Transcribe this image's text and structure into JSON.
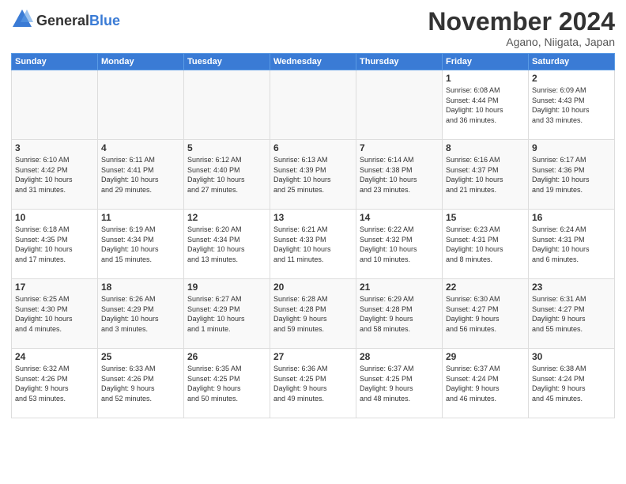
{
  "logo": {
    "general": "General",
    "blue": "Blue"
  },
  "header": {
    "month": "November 2024",
    "location": "Agano, Niigata, Japan"
  },
  "days_of_week": [
    "Sunday",
    "Monday",
    "Tuesday",
    "Wednesday",
    "Thursday",
    "Friday",
    "Saturday"
  ],
  "weeks": [
    [
      {
        "day": "",
        "info": ""
      },
      {
        "day": "",
        "info": ""
      },
      {
        "day": "",
        "info": ""
      },
      {
        "day": "",
        "info": ""
      },
      {
        "day": "",
        "info": ""
      },
      {
        "day": "1",
        "info": "Sunrise: 6:08 AM\nSunset: 4:44 PM\nDaylight: 10 hours\nand 36 minutes."
      },
      {
        "day": "2",
        "info": "Sunrise: 6:09 AM\nSunset: 4:43 PM\nDaylight: 10 hours\nand 33 minutes."
      }
    ],
    [
      {
        "day": "3",
        "info": "Sunrise: 6:10 AM\nSunset: 4:42 PM\nDaylight: 10 hours\nand 31 minutes."
      },
      {
        "day": "4",
        "info": "Sunrise: 6:11 AM\nSunset: 4:41 PM\nDaylight: 10 hours\nand 29 minutes."
      },
      {
        "day": "5",
        "info": "Sunrise: 6:12 AM\nSunset: 4:40 PM\nDaylight: 10 hours\nand 27 minutes."
      },
      {
        "day": "6",
        "info": "Sunrise: 6:13 AM\nSunset: 4:39 PM\nDaylight: 10 hours\nand 25 minutes."
      },
      {
        "day": "7",
        "info": "Sunrise: 6:14 AM\nSunset: 4:38 PM\nDaylight: 10 hours\nand 23 minutes."
      },
      {
        "day": "8",
        "info": "Sunrise: 6:16 AM\nSunset: 4:37 PM\nDaylight: 10 hours\nand 21 minutes."
      },
      {
        "day": "9",
        "info": "Sunrise: 6:17 AM\nSunset: 4:36 PM\nDaylight: 10 hours\nand 19 minutes."
      }
    ],
    [
      {
        "day": "10",
        "info": "Sunrise: 6:18 AM\nSunset: 4:35 PM\nDaylight: 10 hours\nand 17 minutes."
      },
      {
        "day": "11",
        "info": "Sunrise: 6:19 AM\nSunset: 4:34 PM\nDaylight: 10 hours\nand 15 minutes."
      },
      {
        "day": "12",
        "info": "Sunrise: 6:20 AM\nSunset: 4:34 PM\nDaylight: 10 hours\nand 13 minutes."
      },
      {
        "day": "13",
        "info": "Sunrise: 6:21 AM\nSunset: 4:33 PM\nDaylight: 10 hours\nand 11 minutes."
      },
      {
        "day": "14",
        "info": "Sunrise: 6:22 AM\nSunset: 4:32 PM\nDaylight: 10 hours\nand 10 minutes."
      },
      {
        "day": "15",
        "info": "Sunrise: 6:23 AM\nSunset: 4:31 PM\nDaylight: 10 hours\nand 8 minutes."
      },
      {
        "day": "16",
        "info": "Sunrise: 6:24 AM\nSunset: 4:31 PM\nDaylight: 10 hours\nand 6 minutes."
      }
    ],
    [
      {
        "day": "17",
        "info": "Sunrise: 6:25 AM\nSunset: 4:30 PM\nDaylight: 10 hours\nand 4 minutes."
      },
      {
        "day": "18",
        "info": "Sunrise: 6:26 AM\nSunset: 4:29 PM\nDaylight: 10 hours\nand 3 minutes."
      },
      {
        "day": "19",
        "info": "Sunrise: 6:27 AM\nSunset: 4:29 PM\nDaylight: 10 hours\nand 1 minute."
      },
      {
        "day": "20",
        "info": "Sunrise: 6:28 AM\nSunset: 4:28 PM\nDaylight: 9 hours\nand 59 minutes."
      },
      {
        "day": "21",
        "info": "Sunrise: 6:29 AM\nSunset: 4:28 PM\nDaylight: 9 hours\nand 58 minutes."
      },
      {
        "day": "22",
        "info": "Sunrise: 6:30 AM\nSunset: 4:27 PM\nDaylight: 9 hours\nand 56 minutes."
      },
      {
        "day": "23",
        "info": "Sunrise: 6:31 AM\nSunset: 4:27 PM\nDaylight: 9 hours\nand 55 minutes."
      }
    ],
    [
      {
        "day": "24",
        "info": "Sunrise: 6:32 AM\nSunset: 4:26 PM\nDaylight: 9 hours\nand 53 minutes."
      },
      {
        "day": "25",
        "info": "Sunrise: 6:33 AM\nSunset: 4:26 PM\nDaylight: 9 hours\nand 52 minutes."
      },
      {
        "day": "26",
        "info": "Sunrise: 6:35 AM\nSunset: 4:25 PM\nDaylight: 9 hours\nand 50 minutes."
      },
      {
        "day": "27",
        "info": "Sunrise: 6:36 AM\nSunset: 4:25 PM\nDaylight: 9 hours\nand 49 minutes."
      },
      {
        "day": "28",
        "info": "Sunrise: 6:37 AM\nSunset: 4:25 PM\nDaylight: 9 hours\nand 48 minutes."
      },
      {
        "day": "29",
        "info": "Sunrise: 6:37 AM\nSunset: 4:24 PM\nDaylight: 9 hours\nand 46 minutes."
      },
      {
        "day": "30",
        "info": "Sunrise: 6:38 AM\nSunset: 4:24 PM\nDaylight: 9 hours\nand 45 minutes."
      }
    ]
  ]
}
